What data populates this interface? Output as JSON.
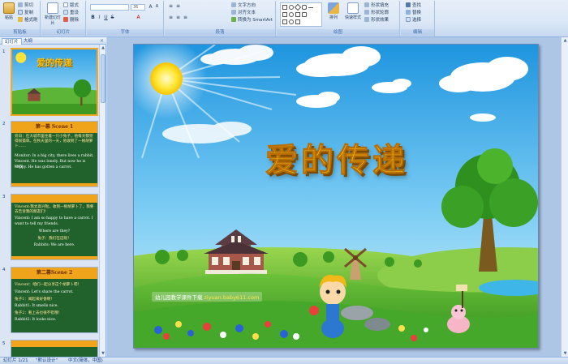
{
  "ribbon": {
    "clipboard": {
      "group": "剪贴板",
      "paste": "粘贴",
      "cut": "剪切",
      "copy": "复制",
      "format_painter": "格式刷"
    },
    "slides": {
      "group": "幻灯片",
      "new_slide": "新建幻灯片",
      "layout": "版式",
      "reset": "重设",
      "delete": "删除"
    },
    "font": {
      "group": "字体",
      "font_size": "36"
    },
    "paragraph": {
      "group": "段落",
      "text_direction": "文字方向",
      "align_text": "对齐文本",
      "smartart": "转换为 SmartArt"
    },
    "drawing": {
      "group": "绘图",
      "arrange": "排列",
      "quick_styles": "快速样式",
      "shape_fill": "形状填充",
      "shape_outline": "形状轮廓",
      "shape_effects": "形状效果"
    },
    "editing": {
      "group": "编辑",
      "find": "查找",
      "replace": "替换",
      "select": "选择"
    }
  },
  "left_panel": {
    "tabs": [
      "幻灯片",
      "大纲"
    ],
    "close": "×",
    "thumbnails": [
      {
        "number": "1",
        "title": "爱的传递"
      },
      {
        "number": "2",
        "heading": "第一幕  Scene 1",
        "lines": [
          "旁白：在大城市里住着一只小兔子，他每天都觉得很孤单。在秋天里的一天，他收到了一根胡萝卜……",
          "Monitor: In a big city, there lives a rabbit,",
          "Vincent. He was lonely. But now he is very",
          "happy. He has gotten a carrot."
        ]
      },
      {
        "number": "3",
        "lines": [
          "Vincent:我太高兴啦，收到一根胡萝卜了，我要去告诉我的朋友们！",
          "Vincent: I am so happy to have a carrot. I",
          "want to tell my friends.",
          "Where are they?",
          "兔子：我们在这呢！",
          "Rabbits: We are here."
        ]
      },
      {
        "number": "4",
        "heading": "第二幕Scene 2",
        "lines": [
          "Vincent：咱们一起分享这个胡萝卜吧！",
          "Vincent: Let's share the carrot.",
          "兔子1：闻起来好香啊！",
          "Rabbit1: It smells nice.",
          "兔子2：看上去也很不错哦！",
          "Rabbit2: It looks nice."
        ]
      },
      {
        "number": "5"
      }
    ]
  },
  "slide": {
    "title": "爱的传递",
    "watermark_text": "幼儿园教学课件下载",
    "watermark_url": "ziyuan.baby611.com"
  },
  "status_bar": {
    "slide_info": "幻灯片 1/21",
    "theme": "\"默认设计\"",
    "language": "中文(简体，中国)"
  },
  "colors": {
    "ribbon_bg": "#dbe7f6",
    "selection": "#f5a623",
    "title_gold": "#f6c61a",
    "scene_green": "#21612c"
  }
}
